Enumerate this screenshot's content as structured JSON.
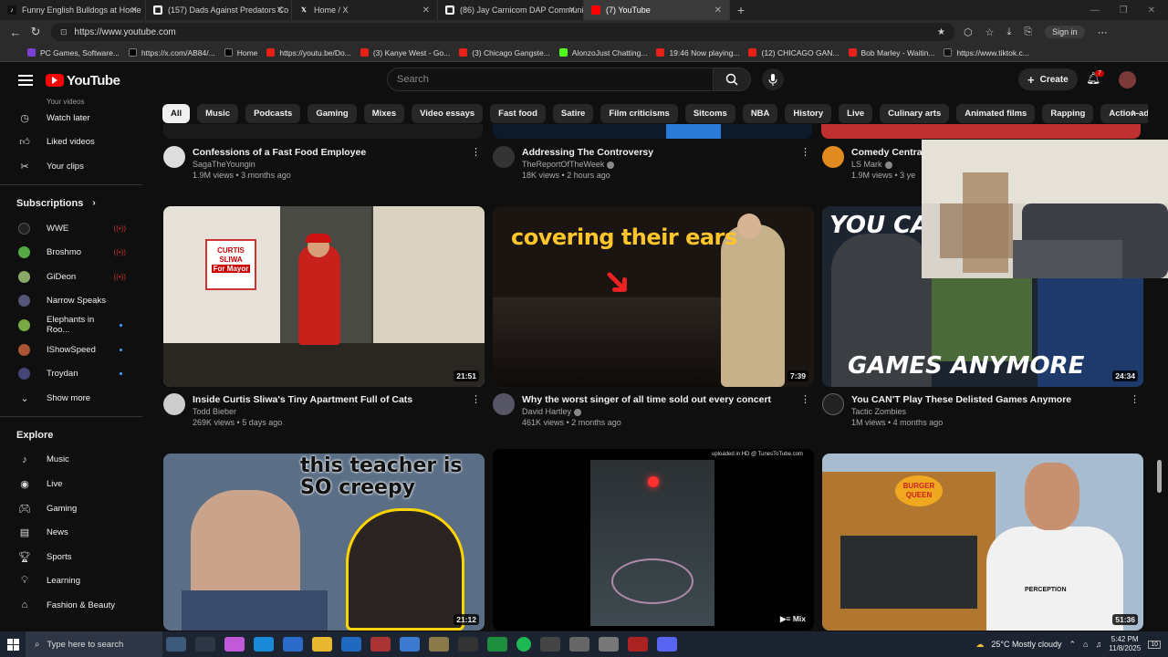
{
  "browser": {
    "tabs": [
      {
        "title": "Funny English Bulldogs at Home",
        "color": "#222"
      },
      {
        "title": "(157) Dads Against Predators Co",
        "color": "#fff"
      },
      {
        "title": "Home / X",
        "color": "#000"
      },
      {
        "title": "(86) Jay Carnicom DAP Communi",
        "color": "#fff"
      },
      {
        "title": "(7) YouTube",
        "color": "#ff0000"
      }
    ],
    "url": "https://www.youtube.com",
    "sign_in": "Sign in",
    "bookmarks": [
      "PC Games, Software...",
      "https://x.com/AB84/...",
      "Home",
      "https://youtu.be/Do...",
      "(3) Kanye West - Go...",
      "(3) Chicago Gangste...",
      "AlonzoJust Chatting...",
      "19:46 Now playing...",
      "(12) CHICAGO GAN...",
      "Bob Marley - Waitin...",
      "https://www.tiktok.c..."
    ]
  },
  "youtube": {
    "logo": "YouTube",
    "search_placeholder": "Search",
    "create_label": "Create",
    "notification_count": "7"
  },
  "sidebar": {
    "top_items": [
      "Your videos",
      "Watch later",
      "Liked videos",
      "Your clips"
    ],
    "subscriptions_heading": "Subscriptions",
    "subscriptions": [
      {
        "name": "WWE",
        "status": "live",
        "color": "#222"
      },
      {
        "name": "Broshmo",
        "status": "live",
        "color": "#5a4"
      },
      {
        "name": "GiDeon",
        "status": "live",
        "color": "#8a6"
      },
      {
        "name": "Narrow Speaks",
        "status": "",
        "color": "#557"
      },
      {
        "name": "Elephants in Roo...",
        "status": "new",
        "color": "#7a4"
      },
      {
        "name": "IShowSpeed",
        "status": "new",
        "color": "#a53"
      },
      {
        "name": "Troydan",
        "status": "new",
        "color": "#447"
      }
    ],
    "show_more": "Show more",
    "explore_heading": "Explore",
    "explore": [
      "Music",
      "Live",
      "Gaming",
      "News",
      "Sports",
      "Learning",
      "Fashion & Beauty"
    ]
  },
  "chips": [
    "All",
    "Music",
    "Podcasts",
    "Gaming",
    "Mixes",
    "Video essays",
    "Fast food",
    "Satire",
    "Film criticisms",
    "Sitcoms",
    "NBA",
    "History",
    "Live",
    "Culinary arts",
    "Animated films",
    "Rapping",
    "Action-adventure games"
  ],
  "row1": [
    {
      "title": "Confessions of a Fast Food Employee",
      "channel": "SagaTheYoungin",
      "views": "1.9M views",
      "age": "3 months ago",
      "verified": false
    },
    {
      "title": "Addressing The Controversy",
      "channel": "TheReportOfTheWeek",
      "views": "18K views",
      "age": "2 hours ago",
      "verified": true
    },
    {
      "title": "Comedy Central",
      "channel": "LS Mark",
      "views": "1.9M views",
      "age": "3 ye",
      "verified": true
    }
  ],
  "row2": [
    {
      "title": "Inside Curtis Sliwa's Tiny Apartment Full of Cats",
      "channel": "Todd Bieber",
      "views": "269K views",
      "age": "5 days ago",
      "duration": "21:51",
      "verified": false
    },
    {
      "title": "Why the worst singer of all time sold out every concert",
      "channel": "David Hartley",
      "views": "461K views",
      "age": "2 months ago",
      "duration": "7:39",
      "verified": true
    },
    {
      "title": "You CAN'T Play These  Delisted Games Anymore",
      "channel": "Tactic Zombies",
      "views": "1M views",
      "age": "4 months ago",
      "duration": "24:34",
      "verified": false
    }
  ],
  "row3": [
    {
      "duration": "21:12"
    },
    {
      "duration": "Mix"
    },
    {
      "duration": "51:36"
    }
  ],
  "thumb_text": {
    "curtis_sign1": "CURTIS SLIWA",
    "curtis_sign2": "For Mayor",
    "ears": "covering their ears",
    "games_top": "YOU CA",
    "games_bottom": "GAMES ANYMORE",
    "teacher": "this teacher is SO creepy",
    "upload_note": "uploaded in HD @ TunesToTube.com",
    "bk_sign": "BURGER QUEEN",
    "shirt": "PERCEPTION"
  },
  "taskbar": {
    "search_placeholder": "Type here to search",
    "weather": "25°C  Mostly cloudy",
    "time": "5:42 PM",
    "date": "11/8/2025",
    "notif": "10"
  }
}
